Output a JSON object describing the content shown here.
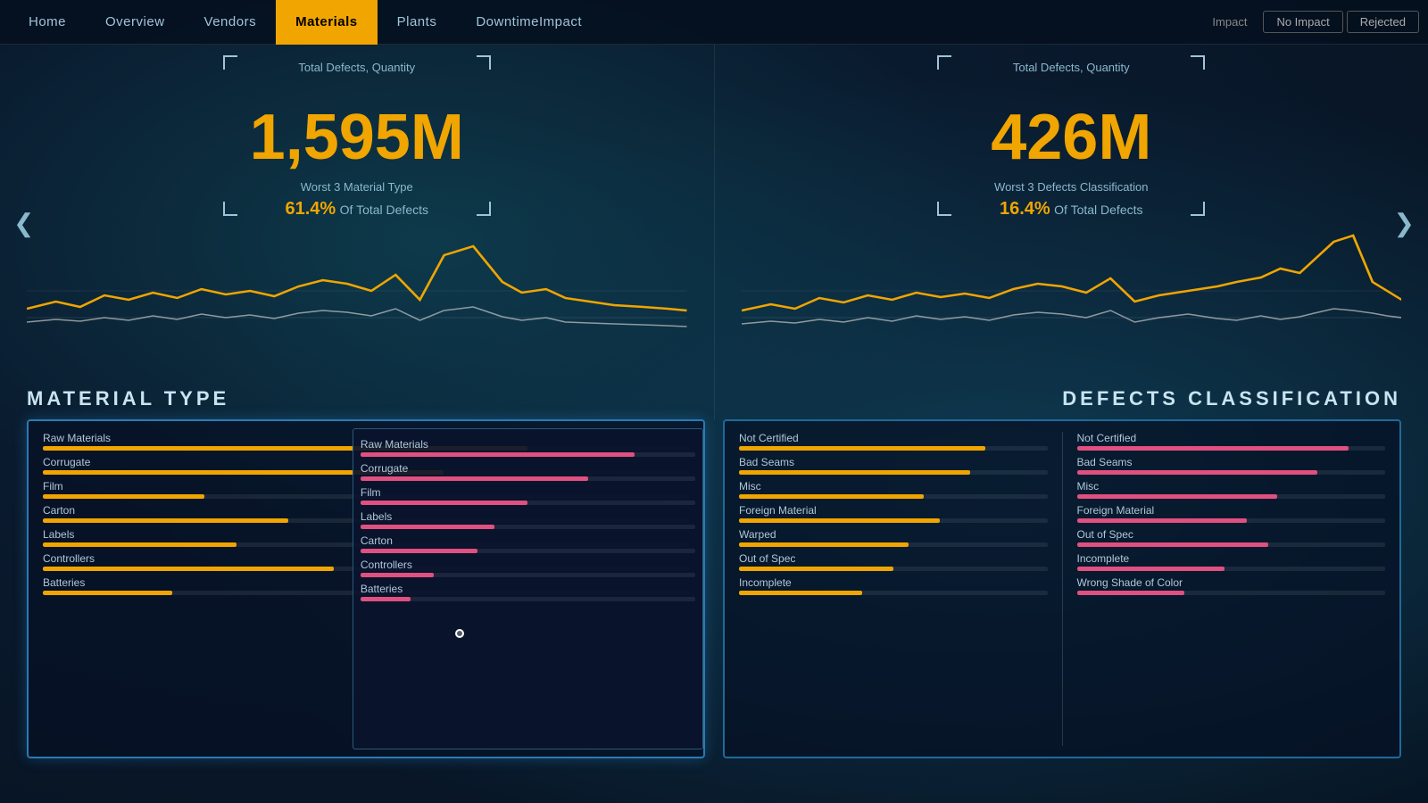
{
  "topbar": {
    "nav_items": [
      {
        "label": "Home",
        "active": false
      },
      {
        "label": "Overview",
        "active": false
      },
      {
        "label": "Vendors",
        "active": false
      },
      {
        "label": "Materials",
        "active": true
      },
      {
        "label": "Plants",
        "active": false
      },
      {
        "label": "DowntimeImpact",
        "active": false
      }
    ],
    "filters": [
      {
        "label": "Impact",
        "type": "impact"
      },
      {
        "label": "No Impact",
        "type": "no-impact"
      },
      {
        "label": "Rejected",
        "type": "rejected"
      }
    ]
  },
  "left_chart": {
    "title": "Total Defects, Quantity",
    "big_number": "1,595M",
    "worst_label": "Worst 3 Material Type",
    "percent": "61.4%",
    "percent_suffix": "Of Total Defects",
    "section_label": "Material Type"
  },
  "right_chart": {
    "title": "Total Defects, Quantity",
    "big_number": "426M",
    "worst_label": "Worst 3 Defects Classification",
    "percent": "16.4%",
    "percent_suffix": "Of Total Defects",
    "section_label": "Defects Classification"
  },
  "material_list_left": [
    {
      "label": "Raw Materials",
      "bar_pct": 75,
      "bar_type": "yellow"
    },
    {
      "label": "Corrugate",
      "bar_pct": 62,
      "bar_type": "yellow"
    },
    {
      "label": "Film",
      "bar_pct": 25,
      "bar_type": "yellow"
    },
    {
      "label": "Carton",
      "bar_pct": 38,
      "bar_type": "yellow"
    },
    {
      "label": "Labels",
      "bar_pct": 30,
      "bar_type": "yellow"
    },
    {
      "label": "Controllers",
      "bar_pct": 45,
      "bar_type": "yellow"
    },
    {
      "label": "Batteries",
      "bar_pct": 20,
      "bar_type": "yellow"
    }
  ],
  "material_list_overlay": [
    {
      "label": "Raw Materials",
      "bar_pct": 82,
      "bar_type": "pink"
    },
    {
      "label": "Corrugate",
      "bar_pct": 68,
      "bar_type": "pink"
    },
    {
      "label": "Film",
      "bar_pct": 50,
      "bar_type": "pink"
    },
    {
      "label": "Labels",
      "bar_pct": 40,
      "bar_type": "pink"
    },
    {
      "label": "Carton",
      "bar_pct": 35,
      "bar_type": "pink"
    },
    {
      "label": "Controllers",
      "bar_pct": 22,
      "bar_type": "pink"
    },
    {
      "label": "Batteries",
      "bar_pct": 15,
      "bar_type": "pink"
    }
  ],
  "defects_left": [
    {
      "label": "Not Certified",
      "bar_pct": 80,
      "bar_type": "yellow"
    },
    {
      "label": "Bad Seams",
      "bar_pct": 75,
      "bar_type": "yellow"
    },
    {
      "label": "Misc",
      "bar_pct": 60,
      "bar_type": "yellow"
    },
    {
      "label": "Foreign Material",
      "bar_pct": 65,
      "bar_type": "yellow"
    },
    {
      "label": "Warped",
      "bar_pct": 55,
      "bar_type": "yellow"
    },
    {
      "label": "Out of Spec",
      "bar_pct": 50,
      "bar_type": "yellow"
    },
    {
      "label": "Incomplete",
      "bar_pct": 40,
      "bar_type": "yellow"
    }
  ],
  "defects_right": [
    {
      "label": "Not Certified",
      "bar_pct": 88,
      "bar_type": "pink"
    },
    {
      "label": "Bad Seams",
      "bar_pct": 78,
      "bar_type": "pink"
    },
    {
      "label": "Misc",
      "bar_pct": 65,
      "bar_type": "pink"
    },
    {
      "label": "Foreign Material",
      "bar_pct": 55,
      "bar_type": "pink"
    },
    {
      "label": "Out of Spec",
      "bar_pct": 62,
      "bar_type": "pink"
    },
    {
      "label": "Incomplete",
      "bar_pct": 48,
      "bar_type": "pink"
    },
    {
      "label": "Wrong Shade of Color",
      "bar_pct": 35,
      "bar_type": "pink"
    }
  ],
  "arrows": {
    "left": "❮",
    "right": "❯"
  }
}
